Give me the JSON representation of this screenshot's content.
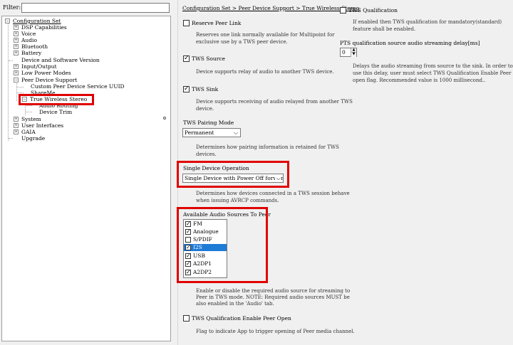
{
  "filter": {
    "label": "Filter:",
    "value": ""
  },
  "tree": {
    "items": [
      {
        "label": "Configuration Set",
        "toggle": "−"
      },
      {
        "label": "DSP Capabilities",
        "toggle": "+"
      },
      {
        "label": "Voice",
        "toggle": "+"
      },
      {
        "label": "Audio",
        "toggle": "+"
      },
      {
        "label": "Bluetooth",
        "toggle": "+"
      },
      {
        "label": "Battery",
        "toggle": "+"
      },
      {
        "label": "Device and Software Version",
        "toggle": ""
      },
      {
        "label": "Input/Output",
        "toggle": "+"
      },
      {
        "label": "Low Power Modes",
        "toggle": "+"
      },
      {
        "label": "Peer Device Support",
        "toggle": "−"
      },
      {
        "label": "Custom Peer Device Service UUID",
        "toggle": ""
      },
      {
        "label": "ShareMe",
        "toggle": ""
      },
      {
        "label": "True Wireless Stereo",
        "toggle": "−"
      },
      {
        "label": "Audio Routing",
        "toggle": ""
      },
      {
        "label": "Device Trim",
        "toggle": ""
      },
      {
        "label": "System",
        "toggle": "+"
      },
      {
        "label": "User Interfaces",
        "toggle": "+"
      },
      {
        "label": "GAIA",
        "toggle": "+"
      },
      {
        "label": "Upgrade",
        "toggle": ""
      }
    ]
  },
  "main": {
    "breadcrumb": "Configuration Set > Peer Device Support > True Wireless Stereo",
    "reserve_peer_link": {
      "label": "Reserve Peer Link",
      "checked": false,
      "desc": [
        "Reserves one link normally available for Multipoint for",
        "exclusive use by a TWS peer device."
      ]
    },
    "tws_source": {
      "label": "TWS Source",
      "checked": true,
      "desc": [
        "Device supports relay of audio to another TWS device."
      ]
    },
    "tws_sink": {
      "label": "TWS Sink",
      "checked": true,
      "desc": [
        "Device supports receiving of audio relayed from another TWS",
        "device."
      ]
    },
    "pairing_mode": {
      "label": "TWS Pairing Mode",
      "value": "Permanent",
      "desc": [
        "Determines how pairing information is retained for TWS",
        "devices."
      ]
    },
    "single_device": {
      "label": "Single Device Operation",
      "value": "Single Device with Power Off forwardin",
      "desc": [
        "Determines how devices connected in a TWS session behave",
        "when issuing AVRCP commands."
      ]
    },
    "audio_sources": {
      "label": "Available Audio Sources To Peer",
      "items": [
        {
          "label": "FM",
          "checked": true
        },
        {
          "label": "Analogue",
          "checked": true
        },
        {
          "label": "S/PDIF",
          "checked": false
        },
        {
          "label": "I2S",
          "checked": true,
          "selected": true
        },
        {
          "label": "USB",
          "checked": true
        },
        {
          "label": "A2DP1",
          "checked": true
        },
        {
          "label": "A2DP2",
          "checked": true
        }
      ],
      "desc": [
        "Enable or disable the required audio source for streaming to",
        "Peer in TWS mode. NOTE: Required audio sources MUST be",
        "also enabled in the 'Audio' tab."
      ]
    },
    "peer_open": {
      "label": "TWS Qualification Enable Peer Open",
      "checked": false,
      "desc": [
        "Flag to indicate App to trigger opening of Peer media channel."
      ]
    }
  },
  "right": {
    "tws_qualification": {
      "label": "TWS Qualification",
      "checked": false,
      "desc": [
        "If enabled then TWS qualification for mandatory(standard)",
        "feature shall be enabled."
      ]
    },
    "pts_delay": {
      "label": "PTS qualification source audio streaming delay[ms]",
      "value": "0",
      "desc": [
        "Delays the audio streaming from source to the sink. In order to",
        "use this delay, user must select TWS Qualification Enable Peer",
        "open flag. Recommended value is 1000 millisecond.."
      ]
    }
  },
  "icons": {
    "check": "✓",
    "chevron": "⌵"
  },
  "colors": {
    "highlight": "#e00000",
    "selection": "#1e7bd6"
  }
}
